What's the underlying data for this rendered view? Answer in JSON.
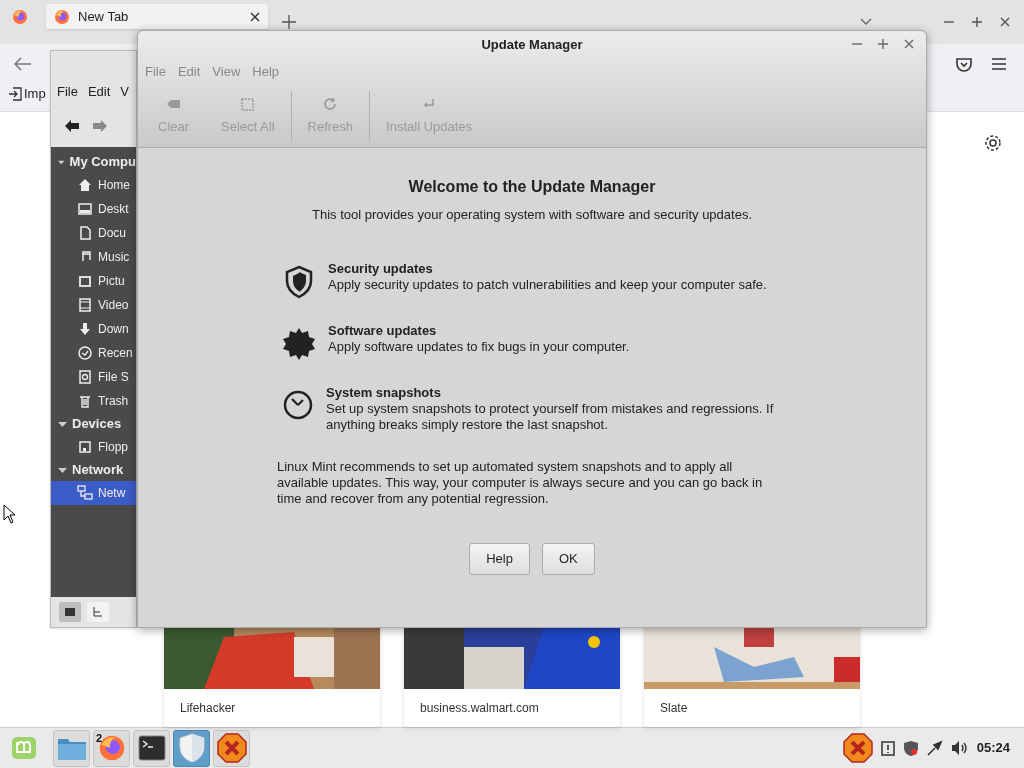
{
  "browser": {
    "tabs": [
      {
        "label": "New Tab",
        "selected": true
      }
    ],
    "bookmarks": [
      "Imp"
    ],
    "tiles": [
      {
        "label": "Lifehacker",
        "kind": "picture"
      },
      {
        "label": "business.walmart.com",
        "kind": "picture"
      },
      {
        "label": "Slate",
        "kind": "picture"
      }
    ]
  },
  "file_manager": {
    "menu": [
      "File",
      "Edit",
      "V"
    ],
    "sidebar": [
      {
        "label": "My Compu",
        "expanded": true,
        "children": [
          {
            "label": "Home",
            "selected": false
          },
          {
            "label": "Deskt",
            "selected": false
          },
          {
            "label": "Docu",
            "selected": false
          },
          {
            "label": "Music",
            "selected": false
          },
          {
            "label": "Pictu",
            "selected": false
          },
          {
            "label": "Video",
            "selected": false
          },
          {
            "label": "Down",
            "selected": false
          },
          {
            "label": "Recen",
            "selected": false
          },
          {
            "label": "File S",
            "selected": false
          },
          {
            "label": "Trash",
            "selected": false
          }
        ]
      },
      {
        "label": "Devices",
        "expanded": true,
        "children": [
          {
            "label": "Flopp",
            "selected": false
          }
        ]
      },
      {
        "label": "Network",
        "expanded": true,
        "children": [
          {
            "label": "Netw",
            "selected": true
          }
        ]
      }
    ]
  },
  "update_manager": {
    "title": "Update Manager",
    "menu": [
      "File",
      "Edit",
      "View",
      "Help"
    ],
    "toolbar": [
      {
        "label": "Clear",
        "disabled": true
      },
      {
        "label": "Select All",
        "disabled": true
      },
      {
        "label": "Refresh",
        "disabled": true
      },
      {
        "label": "Install Updates",
        "disabled": true
      }
    ],
    "heading": "Welcome to the Update Manager",
    "subheading": "This tool provides your operating system with software and security updates.",
    "features": [
      {
        "title": "Security updates",
        "text": "Apply security updates to patch vulnerabilities and keep your computer safe."
      },
      {
        "title": "Software updates",
        "text": "Apply software updates to fix bugs in your computer."
      },
      {
        "title": "System snapshots",
        "text": "Set up system snapshots to protect yourself from mistakes and regressions. If anything breaks simply restore the last snapshot."
      }
    ],
    "recommendation": "Linux Mint recommends to set up automated system snapshots and to apply all available updates. This way, your computer is always secure and you can go back in time and recover from any potential regression.",
    "buttons": [
      "Help",
      "OK"
    ]
  },
  "taskbar": {
    "apps": [
      {
        "selected": false
      },
      {
        "badge": "2",
        "selected": false
      },
      {
        "selected": false
      },
      {
        "selected": true
      },
      {
        "selected": false
      }
    ],
    "clock": "05:24"
  }
}
